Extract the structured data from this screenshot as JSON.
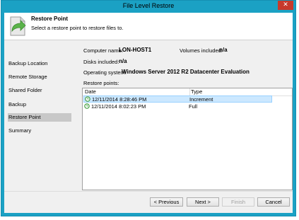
{
  "window": {
    "title": "File Level Restore",
    "close_glyph": "✕"
  },
  "header": {
    "title": "Restore Point",
    "subtitle": "Select a restore point to restore files to.",
    "icon": "restore-arrow-icon"
  },
  "sidebar": {
    "items": [
      {
        "label": "Backup Location"
      },
      {
        "label": "Remote Storage"
      },
      {
        "label": "Shared Folder"
      },
      {
        "label": "Backup"
      },
      {
        "label": "Restore Point",
        "active": true
      },
      {
        "label": "Summary"
      }
    ]
  },
  "details": {
    "computer_name_label": "Computer name:",
    "computer_name": "LON-HOST1",
    "volumes_label": "Volumes included:",
    "volumes": "n/a",
    "disks_label": "Disks included:",
    "disks": "n/a",
    "os_label": "Operating system:",
    "os": "Windows Server 2012 R2 Datacenter Evaluation",
    "restore_points_label": "Restore points:"
  },
  "restore_points": {
    "columns": [
      "Date",
      "Type"
    ],
    "rows": [
      {
        "date": "12/11/2014 8:28:46 PM",
        "type": "Increment",
        "selected": true
      },
      {
        "date": "12/11/2014 8:02:23 PM",
        "type": "Full",
        "selected": false
      }
    ]
  },
  "footer": {
    "previous": "< Previous",
    "next": "Next >",
    "finish": "Finish",
    "cancel": "Cancel"
  },
  "colors": {
    "window_frame": "#1ba1c4",
    "close_button": "#c7392b",
    "selection": "#cce8ff",
    "clock_icon": "#3a9a3a"
  }
}
